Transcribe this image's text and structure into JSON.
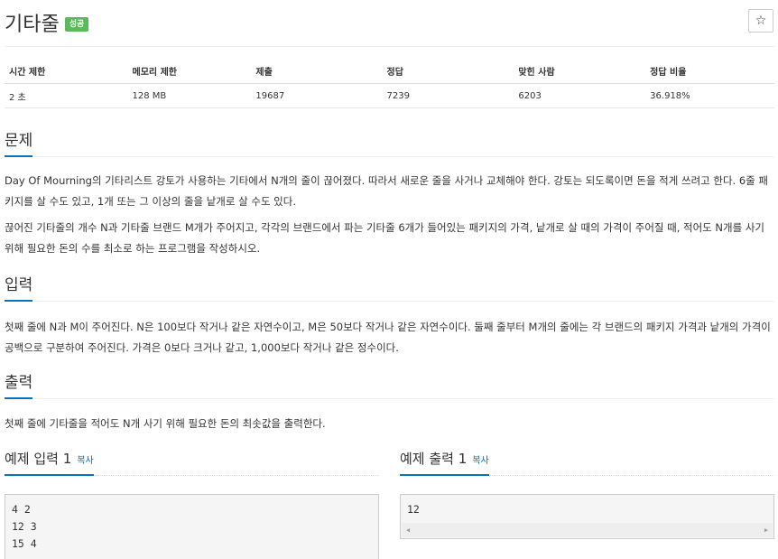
{
  "problem": {
    "title": "기타줄",
    "badge": "성공",
    "star_icon": "☆"
  },
  "info_table": {
    "headers": [
      "시간 제한",
      "메모리 제한",
      "제출",
      "정답",
      "맞힌 사람",
      "정답 비율"
    ],
    "row": [
      "2 초",
      "128 MB",
      "19687",
      "7239",
      "6203",
      "36.918%"
    ]
  },
  "sections": {
    "description": {
      "title": "문제",
      "paragraphs": [
        "Day Of Mourning의 기타리스트 강토가 사용하는 기타에서 N개의 줄이 끊어졌다. 따라서 새로운 줄을 사거나 교체해야 한다. 강토는 되도록이면 돈을 적게 쓰려고 한다. 6줄 패키지를 살 수도 있고, 1개 또는 그 이상의 줄을 낱개로 살 수도 있다.",
        "끊어진 기타줄의 개수 N과 기타줄 브랜드 M개가 주어지고, 각각의 브랜드에서 파는 기타줄 6개가 들어있는 패키지의 가격, 낱개로 살 때의 가격이 주어질 때, 적어도 N개를 사기 위해 필요한 돈의 수를 최소로 하는 프로그램을 작성하시오."
      ]
    },
    "input": {
      "title": "입력",
      "paragraph": "첫째 줄에 N과 M이 주어진다. N은 100보다 작거나 같은 자연수이고, M은 50보다 작거나 같은 자연수이다. 둘째 줄부터 M개의 줄에는 각 브랜드의 패키지 가격과 낱개의 가격이 공백으로 구분하여 주어진다. 가격은 0보다 크거나 같고, 1,000보다 작거나 같은 정수이다."
    },
    "output": {
      "title": "출력",
      "paragraph": "첫째 줄에 기타줄을 적어도 N개 사기 위해 필요한 돈의 최솟값을 출력한다."
    }
  },
  "samples": {
    "input": {
      "title": "예제 입력 1",
      "copy_label": "복사",
      "lines": [
        "4 2",
        "12 3",
        "15 4"
      ]
    },
    "output": {
      "title": "예제 출력 1",
      "copy_label": "복사",
      "lines": [
        "12"
      ]
    }
  },
  "scrollbar": {
    "left_arrow": "◀",
    "right_arrow": "▶"
  }
}
